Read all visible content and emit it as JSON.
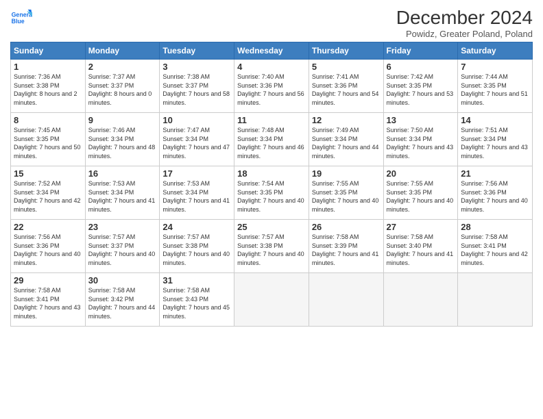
{
  "logo": {
    "line1": "General",
    "line2": "Blue"
  },
  "title": "December 2024",
  "subtitle": "Powidz, Greater Poland, Poland",
  "days_of_week": [
    "Sunday",
    "Monday",
    "Tuesday",
    "Wednesday",
    "Thursday",
    "Friday",
    "Saturday"
  ],
  "weeks": [
    [
      {
        "day": "1",
        "sunrise": "7:36 AM",
        "sunset": "3:38 PM",
        "daylight": "8 hours and 2 minutes."
      },
      {
        "day": "2",
        "sunrise": "7:37 AM",
        "sunset": "3:37 PM",
        "daylight": "8 hours and 0 minutes."
      },
      {
        "day": "3",
        "sunrise": "7:38 AM",
        "sunset": "3:37 PM",
        "daylight": "7 hours and 58 minutes."
      },
      {
        "day": "4",
        "sunrise": "7:40 AM",
        "sunset": "3:36 PM",
        "daylight": "7 hours and 56 minutes."
      },
      {
        "day": "5",
        "sunrise": "7:41 AM",
        "sunset": "3:36 PM",
        "daylight": "7 hours and 54 minutes."
      },
      {
        "day": "6",
        "sunrise": "7:42 AM",
        "sunset": "3:35 PM",
        "daylight": "7 hours and 53 minutes."
      },
      {
        "day": "7",
        "sunrise": "7:44 AM",
        "sunset": "3:35 PM",
        "daylight": "7 hours and 51 minutes."
      }
    ],
    [
      {
        "day": "8",
        "sunrise": "7:45 AM",
        "sunset": "3:35 PM",
        "daylight": "7 hours and 50 minutes."
      },
      {
        "day": "9",
        "sunrise": "7:46 AM",
        "sunset": "3:34 PM",
        "daylight": "7 hours and 48 minutes."
      },
      {
        "day": "10",
        "sunrise": "7:47 AM",
        "sunset": "3:34 PM",
        "daylight": "7 hours and 47 minutes."
      },
      {
        "day": "11",
        "sunrise": "7:48 AM",
        "sunset": "3:34 PM",
        "daylight": "7 hours and 46 minutes."
      },
      {
        "day": "12",
        "sunrise": "7:49 AM",
        "sunset": "3:34 PM",
        "daylight": "7 hours and 44 minutes."
      },
      {
        "day": "13",
        "sunrise": "7:50 AM",
        "sunset": "3:34 PM",
        "daylight": "7 hours and 43 minutes."
      },
      {
        "day": "14",
        "sunrise": "7:51 AM",
        "sunset": "3:34 PM",
        "daylight": "7 hours and 43 minutes."
      }
    ],
    [
      {
        "day": "15",
        "sunrise": "7:52 AM",
        "sunset": "3:34 PM",
        "daylight": "7 hours and 42 minutes."
      },
      {
        "day": "16",
        "sunrise": "7:53 AM",
        "sunset": "3:34 PM",
        "daylight": "7 hours and 41 minutes."
      },
      {
        "day": "17",
        "sunrise": "7:53 AM",
        "sunset": "3:34 PM",
        "daylight": "7 hours and 41 minutes."
      },
      {
        "day": "18",
        "sunrise": "7:54 AM",
        "sunset": "3:35 PM",
        "daylight": "7 hours and 40 minutes."
      },
      {
        "day": "19",
        "sunrise": "7:55 AM",
        "sunset": "3:35 PM",
        "daylight": "7 hours and 40 minutes."
      },
      {
        "day": "20",
        "sunrise": "7:55 AM",
        "sunset": "3:35 PM",
        "daylight": "7 hours and 40 minutes."
      },
      {
        "day": "21",
        "sunrise": "7:56 AM",
        "sunset": "3:36 PM",
        "daylight": "7 hours and 40 minutes."
      }
    ],
    [
      {
        "day": "22",
        "sunrise": "7:56 AM",
        "sunset": "3:36 PM",
        "daylight": "7 hours and 40 minutes."
      },
      {
        "day": "23",
        "sunrise": "7:57 AM",
        "sunset": "3:37 PM",
        "daylight": "7 hours and 40 minutes."
      },
      {
        "day": "24",
        "sunrise": "7:57 AM",
        "sunset": "3:38 PM",
        "daylight": "7 hours and 40 minutes."
      },
      {
        "day": "25",
        "sunrise": "7:57 AM",
        "sunset": "3:38 PM",
        "daylight": "7 hours and 40 minutes."
      },
      {
        "day": "26",
        "sunrise": "7:58 AM",
        "sunset": "3:39 PM",
        "daylight": "7 hours and 41 minutes."
      },
      {
        "day": "27",
        "sunrise": "7:58 AM",
        "sunset": "3:40 PM",
        "daylight": "7 hours and 41 minutes."
      },
      {
        "day": "28",
        "sunrise": "7:58 AM",
        "sunset": "3:41 PM",
        "daylight": "7 hours and 42 minutes."
      }
    ],
    [
      {
        "day": "29",
        "sunrise": "7:58 AM",
        "sunset": "3:41 PM",
        "daylight": "7 hours and 43 minutes."
      },
      {
        "day": "30",
        "sunrise": "7:58 AM",
        "sunset": "3:42 PM",
        "daylight": "7 hours and 44 minutes."
      },
      {
        "day": "31",
        "sunrise": "7:58 AM",
        "sunset": "3:43 PM",
        "daylight": "7 hours and 45 minutes."
      },
      null,
      null,
      null,
      null
    ]
  ]
}
